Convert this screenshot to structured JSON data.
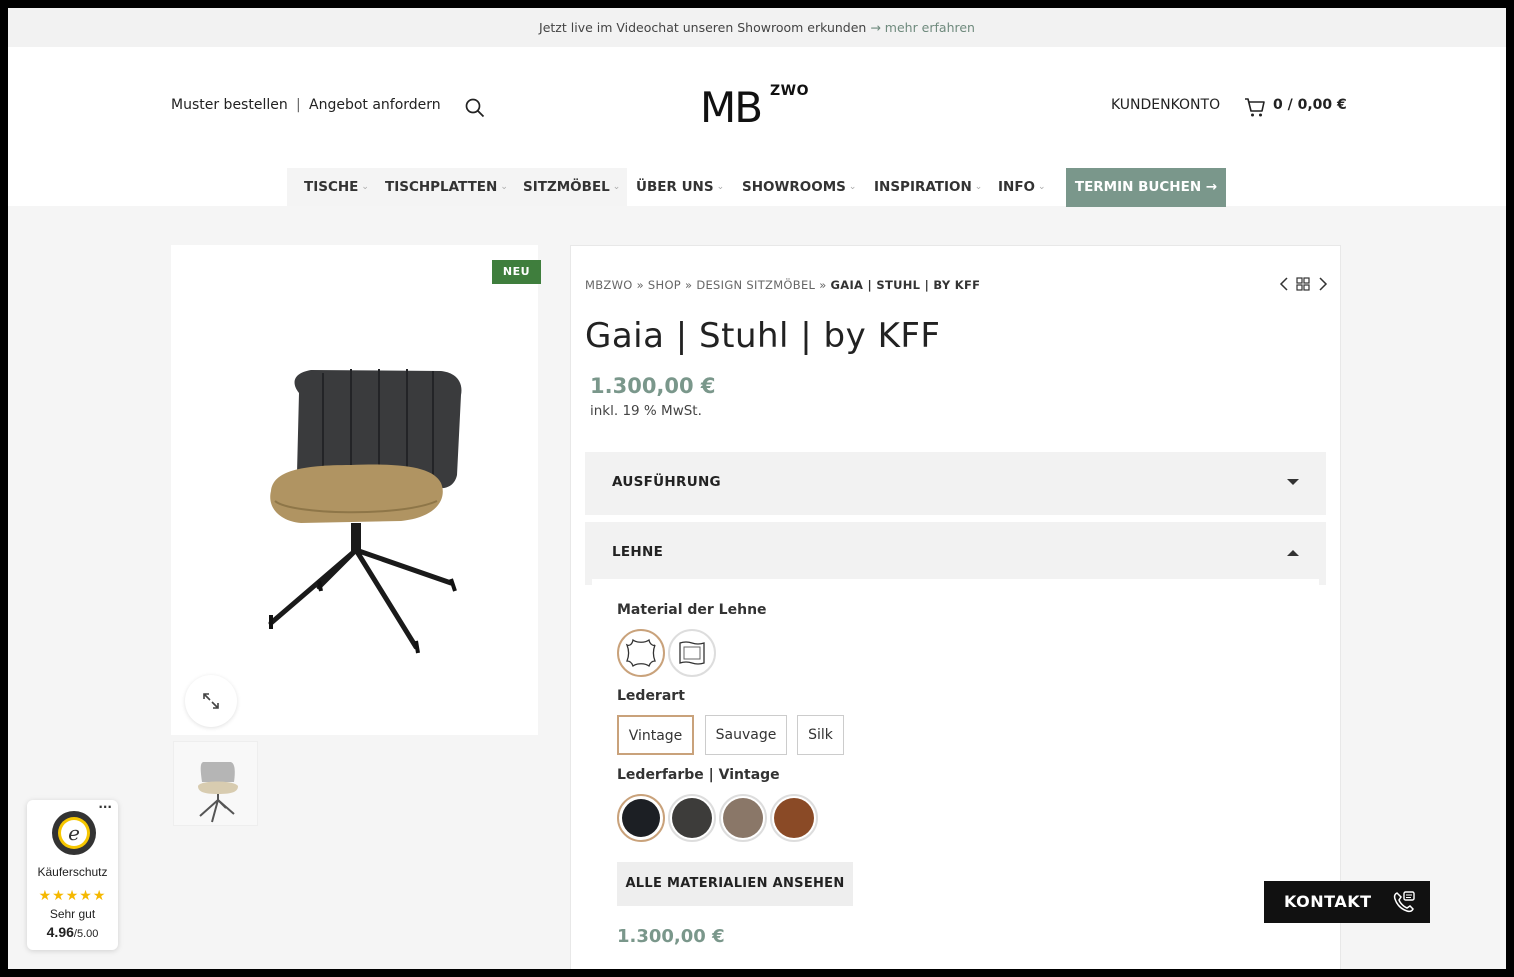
{
  "topbar": {
    "text": "Jetzt live im Videochat unseren Showroom erkunden",
    "link": "→ mehr erfahren"
  },
  "header": {
    "sample_link": "Muster bestellen",
    "separator": "|",
    "quote_link": "Angebot anfordern",
    "logo_main": "MB",
    "logo_sup": "ZWO",
    "account_link": "KUNDENKONTO",
    "cart_summary": "0 / 0,00 €"
  },
  "nav": {
    "items": [
      {
        "label": "TISCHE"
      },
      {
        "label": "TISCHPLATTEN"
      },
      {
        "label": "SITZMÖBEL"
      },
      {
        "label": "ÜBER UNS"
      },
      {
        "label": "SHOWROOMS"
      },
      {
        "label": "INSPIRATION"
      },
      {
        "label": "INFO"
      }
    ],
    "cta": "TERMIN BUCHEN →"
  },
  "gallery": {
    "badge": "NEU"
  },
  "product": {
    "breadcrumb": {
      "home": "MBZWO",
      "sep": "»",
      "shop": "SHOP",
      "category": "DESIGN SITZMÖBEL",
      "current": "GAIA | STUHL | BY KFF"
    },
    "title": "Gaia | Stuhl | by KFF",
    "price": "1.300,00 €",
    "tax_note": "inkl. 19 % MwSt.",
    "accordion": [
      {
        "title": "AUSFÜHRUNG",
        "state": "collapsed"
      },
      {
        "title": "LEHNE",
        "state": "expanded"
      }
    ],
    "material_label": "Material der Lehne",
    "leather_type_label": "Lederart",
    "leather_types": [
      "Vintage",
      "Sauvage",
      "Silk"
    ],
    "selected_leather_type": "Vintage",
    "leather_color_label": "Lederfarbe | Vintage",
    "leather_colors": [
      "#1c1f24",
      "#3d3c3a",
      "#8a7768",
      "#8a4a26"
    ],
    "all_materials_button": "ALLE MATERIALIEN ANSEHEN",
    "price_bottom": "1.300,00 €"
  },
  "trust_badge": {
    "menu": "···",
    "label": "Käuferschutz",
    "stars": "★★★★★",
    "rating_text": "Sehr gut",
    "score": "4.96",
    "score_max": "/5.00"
  },
  "contact_button": {
    "label": "KONTAKT"
  },
  "colors": {
    "accent": "#7a978b",
    "badge_green": "#3f7e3d",
    "star": "#f5b800"
  }
}
